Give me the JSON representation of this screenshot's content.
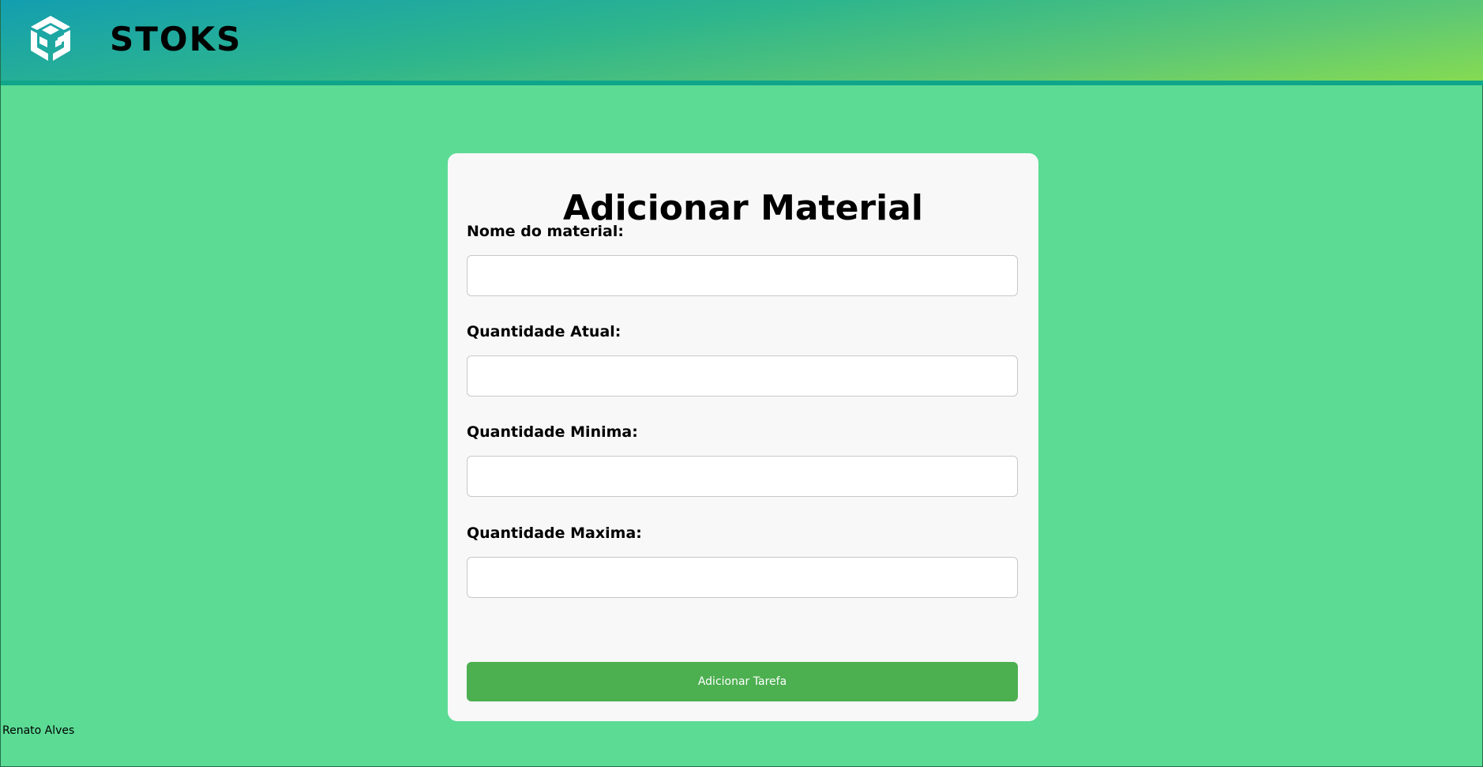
{
  "header": {
    "brand": "STOKS",
    "logo_icon": "cube-logo-icon",
    "gradient_colors": [
      "#139eb0",
      "#2db58d",
      "#5ec874",
      "#85db52"
    ]
  },
  "form": {
    "title": "Adicionar Material",
    "fields": [
      {
        "label": "Nome do material:",
        "value": "",
        "placeholder": ""
      },
      {
        "label": "Quantidade Atual:",
        "value": "",
        "placeholder": ""
      },
      {
        "label": "Quantidade Minima:",
        "value": "",
        "placeholder": ""
      },
      {
        "label": "Quantidade Maxima:",
        "value": "",
        "placeholder": ""
      }
    ],
    "submit_label": "Adicionar Tarefa"
  },
  "footer": {
    "author": "Renato Alves"
  },
  "colors": {
    "page_background": "#5cdb95",
    "card_background": "#f8f8f8",
    "button": "#4caf50",
    "header_border": "#0fa58a"
  }
}
